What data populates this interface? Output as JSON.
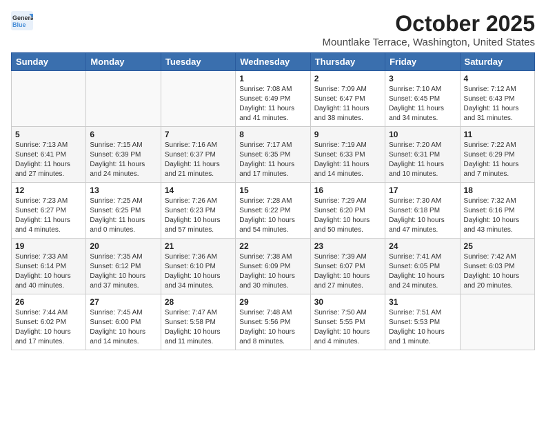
{
  "logo": {
    "text_general": "General",
    "text_blue": "Blue"
  },
  "header": {
    "title": "October 2025",
    "subtitle": "Mountlake Terrace, Washington, United States"
  },
  "days_of_week": [
    "Sunday",
    "Monday",
    "Tuesday",
    "Wednesday",
    "Thursday",
    "Friday",
    "Saturday"
  ],
  "weeks": [
    [
      {
        "day": "",
        "info": ""
      },
      {
        "day": "",
        "info": ""
      },
      {
        "day": "",
        "info": ""
      },
      {
        "day": "1",
        "info": "Sunrise: 7:08 AM\nSunset: 6:49 PM\nDaylight: 11 hours\nand 41 minutes."
      },
      {
        "day": "2",
        "info": "Sunrise: 7:09 AM\nSunset: 6:47 PM\nDaylight: 11 hours\nand 38 minutes."
      },
      {
        "day": "3",
        "info": "Sunrise: 7:10 AM\nSunset: 6:45 PM\nDaylight: 11 hours\nand 34 minutes."
      },
      {
        "day": "4",
        "info": "Sunrise: 7:12 AM\nSunset: 6:43 PM\nDaylight: 11 hours\nand 31 minutes."
      }
    ],
    [
      {
        "day": "5",
        "info": "Sunrise: 7:13 AM\nSunset: 6:41 PM\nDaylight: 11 hours\nand 27 minutes."
      },
      {
        "day": "6",
        "info": "Sunrise: 7:15 AM\nSunset: 6:39 PM\nDaylight: 11 hours\nand 24 minutes."
      },
      {
        "day": "7",
        "info": "Sunrise: 7:16 AM\nSunset: 6:37 PM\nDaylight: 11 hours\nand 21 minutes."
      },
      {
        "day": "8",
        "info": "Sunrise: 7:17 AM\nSunset: 6:35 PM\nDaylight: 11 hours\nand 17 minutes."
      },
      {
        "day": "9",
        "info": "Sunrise: 7:19 AM\nSunset: 6:33 PM\nDaylight: 11 hours\nand 14 minutes."
      },
      {
        "day": "10",
        "info": "Sunrise: 7:20 AM\nSunset: 6:31 PM\nDaylight: 11 hours\nand 10 minutes."
      },
      {
        "day": "11",
        "info": "Sunrise: 7:22 AM\nSunset: 6:29 PM\nDaylight: 11 hours\nand 7 minutes."
      }
    ],
    [
      {
        "day": "12",
        "info": "Sunrise: 7:23 AM\nSunset: 6:27 PM\nDaylight: 11 hours\nand 4 minutes."
      },
      {
        "day": "13",
        "info": "Sunrise: 7:25 AM\nSunset: 6:25 PM\nDaylight: 11 hours\nand 0 minutes."
      },
      {
        "day": "14",
        "info": "Sunrise: 7:26 AM\nSunset: 6:23 PM\nDaylight: 10 hours\nand 57 minutes."
      },
      {
        "day": "15",
        "info": "Sunrise: 7:28 AM\nSunset: 6:22 PM\nDaylight: 10 hours\nand 54 minutes."
      },
      {
        "day": "16",
        "info": "Sunrise: 7:29 AM\nSunset: 6:20 PM\nDaylight: 10 hours\nand 50 minutes."
      },
      {
        "day": "17",
        "info": "Sunrise: 7:30 AM\nSunset: 6:18 PM\nDaylight: 10 hours\nand 47 minutes."
      },
      {
        "day": "18",
        "info": "Sunrise: 7:32 AM\nSunset: 6:16 PM\nDaylight: 10 hours\nand 43 minutes."
      }
    ],
    [
      {
        "day": "19",
        "info": "Sunrise: 7:33 AM\nSunset: 6:14 PM\nDaylight: 10 hours\nand 40 minutes."
      },
      {
        "day": "20",
        "info": "Sunrise: 7:35 AM\nSunset: 6:12 PM\nDaylight: 10 hours\nand 37 minutes."
      },
      {
        "day": "21",
        "info": "Sunrise: 7:36 AM\nSunset: 6:10 PM\nDaylight: 10 hours\nand 34 minutes."
      },
      {
        "day": "22",
        "info": "Sunrise: 7:38 AM\nSunset: 6:09 PM\nDaylight: 10 hours\nand 30 minutes."
      },
      {
        "day": "23",
        "info": "Sunrise: 7:39 AM\nSunset: 6:07 PM\nDaylight: 10 hours\nand 27 minutes."
      },
      {
        "day": "24",
        "info": "Sunrise: 7:41 AM\nSunset: 6:05 PM\nDaylight: 10 hours\nand 24 minutes."
      },
      {
        "day": "25",
        "info": "Sunrise: 7:42 AM\nSunset: 6:03 PM\nDaylight: 10 hours\nand 20 minutes."
      }
    ],
    [
      {
        "day": "26",
        "info": "Sunrise: 7:44 AM\nSunset: 6:02 PM\nDaylight: 10 hours\nand 17 minutes."
      },
      {
        "day": "27",
        "info": "Sunrise: 7:45 AM\nSunset: 6:00 PM\nDaylight: 10 hours\nand 14 minutes."
      },
      {
        "day": "28",
        "info": "Sunrise: 7:47 AM\nSunset: 5:58 PM\nDaylight: 10 hours\nand 11 minutes."
      },
      {
        "day": "29",
        "info": "Sunrise: 7:48 AM\nSunset: 5:56 PM\nDaylight: 10 hours\nand 8 minutes."
      },
      {
        "day": "30",
        "info": "Sunrise: 7:50 AM\nSunset: 5:55 PM\nDaylight: 10 hours\nand 4 minutes."
      },
      {
        "day": "31",
        "info": "Sunrise: 7:51 AM\nSunset: 5:53 PM\nDaylight: 10 hours\nand 1 minute."
      },
      {
        "day": "",
        "info": ""
      }
    ]
  ]
}
